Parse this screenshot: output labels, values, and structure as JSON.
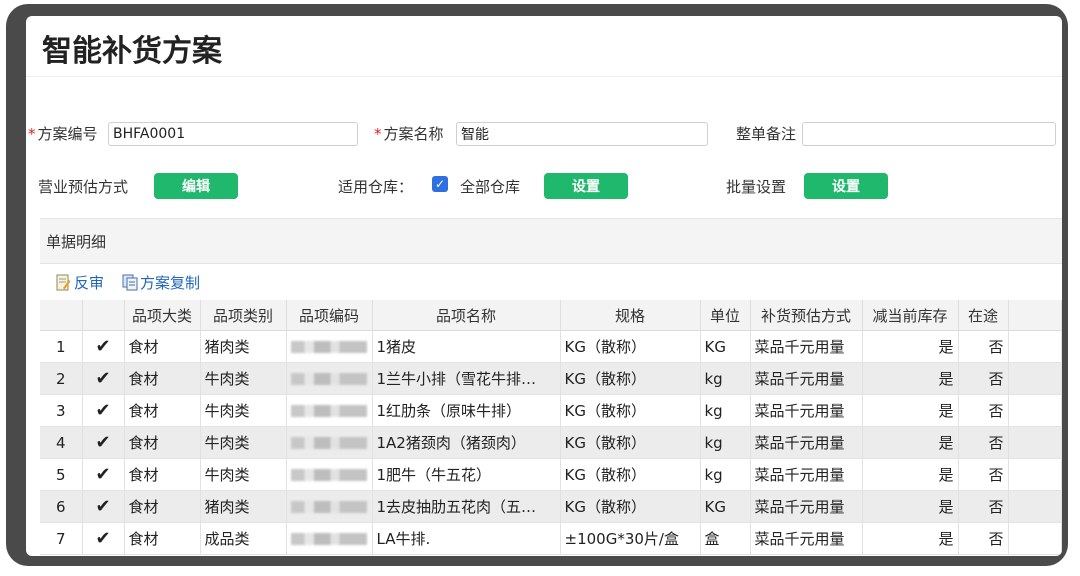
{
  "page": {
    "title": "智能补货方案"
  },
  "form": {
    "plan_code_label": "方案编号",
    "plan_code_value": "BHFA0001",
    "plan_name_label": "方案名称",
    "plan_name_value": "智能",
    "remark_label": "整单备注",
    "remark_value": "",
    "forecast_label": "营业预估方式",
    "forecast_button": "编辑",
    "warehouse_label": "适用仓库：",
    "warehouse_checkbox_label": "全部仓库",
    "warehouse_button": "设置",
    "batch_label": "批量设置",
    "batch_button": "设置"
  },
  "section": {
    "title": "单据明细"
  },
  "toolbar": {
    "reverse_label": "反审",
    "copy_label": "方案复制"
  },
  "table": {
    "headers": [
      "",
      "",
      "品项大类",
      "品项类别",
      "品项编码",
      "品项名称",
      "规格",
      "单位",
      "补货预估方式",
      "减当前库存",
      "在途"
    ],
    "rows": [
      [
        "1",
        "食材",
        "猪肉类",
        "1猪皮",
        "KG（散称）",
        "KG",
        "菜品千元用量",
        "是",
        "否"
      ],
      [
        "2",
        "食材",
        "牛肉类",
        "1兰牛小排（雪花牛排…",
        "KG（散称）",
        "kg",
        "菜品千元用量",
        "是",
        "否"
      ],
      [
        "3",
        "食材",
        "牛肉类",
        "1红肋条（原味牛排）",
        "KG（散称）",
        "kg",
        "菜品千元用量",
        "是",
        "否"
      ],
      [
        "4",
        "食材",
        "牛肉类",
        "1A2猪颈肉（猪颈肉）",
        "KG（散称）",
        "kg",
        "菜品千元用量",
        "是",
        "否"
      ],
      [
        "5",
        "食材",
        "牛肉类",
        "1肥牛（牛五花）",
        "KG（散称）",
        "kg",
        "菜品千元用量",
        "是",
        "否"
      ],
      [
        "6",
        "食材",
        "猪肉类",
        "1去皮抽肋五花肉（五…",
        "KG（散称）",
        "KG",
        "菜品千元用量",
        "是",
        "否"
      ],
      [
        "7",
        "食材",
        "成品类",
        "LA牛排.",
        "±100G*30片/盒",
        "盒",
        "菜品千元用量",
        "是",
        "否"
      ]
    ]
  },
  "colors": {
    "accent_green": "#1fb86c",
    "link_blue": "#2266bb",
    "required_red": "#e02020"
  }
}
